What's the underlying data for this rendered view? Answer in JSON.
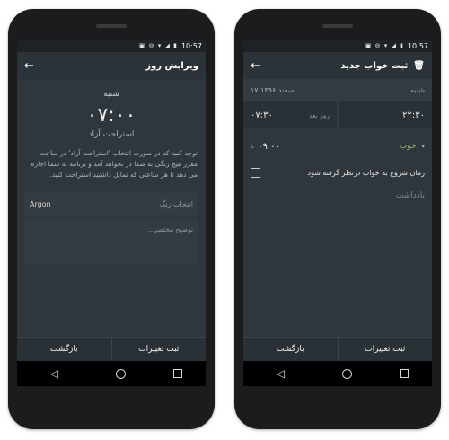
{
  "status_bar": {
    "time": "10:57",
    "icons": "▣ ⊖ ▾ ◢ ▮"
  },
  "nav": {
    "back": "◁",
    "home": "",
    "recent": ""
  },
  "left_screen": {
    "title": "ویرایش روز",
    "back_icon": "←",
    "day_name": "شنبه",
    "big_time": "۰۷:۰۰",
    "subtitle": "استراحت آزاد",
    "description": "توجه کنید که در صورت انتخاب 'استراحت آزاد' در ساعت مقرر هیچ زنگی به صدا در نخواهد آمد و برنامه به شما اجازه می دهد تا هر ساعتی که تمایل داشتید استراحت کنید.",
    "ringtone_label": "انتخاب زنگ",
    "ringtone_value": "Argon",
    "note_placeholder": "توضیح مختصر...",
    "buttons": {
      "save": "ثبت تغییرات",
      "back": "بازگشت"
    }
  },
  "right_screen": {
    "title": "ثبت خواب جدید",
    "back_icon": "←",
    "trash_icon": "🗑",
    "day_name": "شنبه",
    "date": "۱۷ اسفند ۱۳۹۶",
    "sleep_time": "۲۲:۳۰",
    "wake_time_next": "۰۷:۳۰",
    "next_day_label": "روز بعد",
    "quality_value": "خوب",
    "caret": "▾",
    "wake_time": "۰۹:۰۰",
    "wake_prefix": "تا",
    "checkbox_label": "زمان شروع به خواب درنظر گرفته شود",
    "notes_placeholder": "یادداشت",
    "buttons": {
      "save": "ثبت تغییرات",
      "back": "بازگشت"
    }
  }
}
